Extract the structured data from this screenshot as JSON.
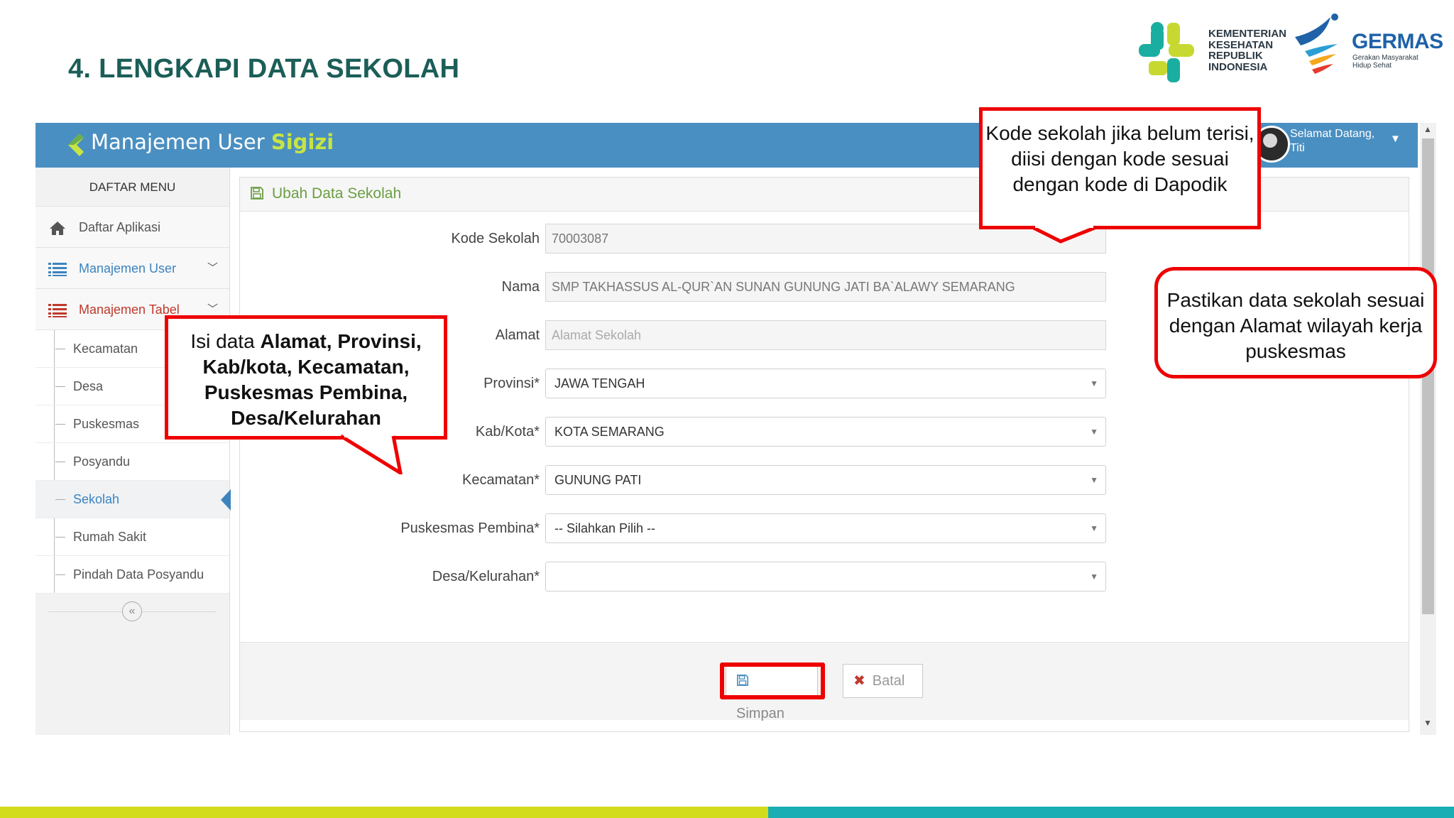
{
  "slide": {
    "title": "4. LENGKAPI DATA SEKOLAH",
    "kemenkes_lines": [
      "KEMENTERIAN",
      "KESEHATAN",
      "REPUBLIK",
      "INDONESIA"
    ],
    "germas_word": "GERMAS",
    "germas_sub": [
      "Gerakan Masyarakat",
      "Hidup Sehat"
    ]
  },
  "app": {
    "brand": "Manajemen User",
    "brand_accent": "Sigizi",
    "welcome_line1": "Selamat Datang,",
    "welcome_line2": "Titi"
  },
  "sidebar": {
    "title": "DAFTAR MENU",
    "items": [
      {
        "label": "Daftar Aplikasi",
        "icon": "home-icon"
      },
      {
        "label": "Manajemen User",
        "icon": "list-icon"
      },
      {
        "label": "Manajemen Tabel",
        "icon": "list-icon"
      }
    ],
    "subitems": [
      "Kecamatan",
      "Desa",
      "Puskesmas",
      "Posyandu",
      "Sekolah",
      "Rumah Sakit",
      "Pindah Data Posyandu"
    ],
    "active": "Sekolah"
  },
  "panel": {
    "title": "Ubah Data Sekolah",
    "fields": [
      {
        "label": "Kode Sekolah",
        "value": "70003087",
        "type": "input"
      },
      {
        "label": "Nama",
        "value": "SMP TAKHASSUS AL-QUR`AN SUNAN GUNUNG JATI BA`ALAWY SEMARANG",
        "type": "input"
      },
      {
        "label": "Alamat",
        "placeholder": "Alamat Sekolah",
        "type": "input"
      },
      {
        "label": "Provinsi*",
        "value": "JAWA TENGAH",
        "type": "select"
      },
      {
        "label": "Kab/Kota*",
        "value": "KOTA SEMARANG",
        "type": "select"
      },
      {
        "label": "Kecamatan*",
        "value": "GUNUNG PATI",
        "type": "select"
      },
      {
        "label": "Puskesmas Pembina*",
        "value": "-- Silahkan Pilih --",
        "type": "select"
      },
      {
        "label": "Desa/Kelurahan*",
        "value": "",
        "type": "select"
      }
    ],
    "save_label": "Simpan",
    "cancel_label": "Batal"
  },
  "callouts": {
    "left_pre": "Isi data ",
    "left_bold": "Alamat, Provinsi, Kab/kota, Kecamatan, Puskesmas Pembina, Desa/Kelurahan",
    "top": "Kode sekolah jika belum terisi, diisi dengan kode sesuai dengan kode di Dapodik",
    "right": "Pastikan data sekolah sesuai dengan Alamat wilayah kerja puskesmas"
  },
  "colors": {
    "topbar": "#4a8fc1",
    "accent_green": "#c7e542",
    "callout_red": "#ee0000",
    "title_teal": "#1b5e57",
    "bar_lime": "#d3dc1a",
    "bar_teal": "#18aeb3"
  }
}
